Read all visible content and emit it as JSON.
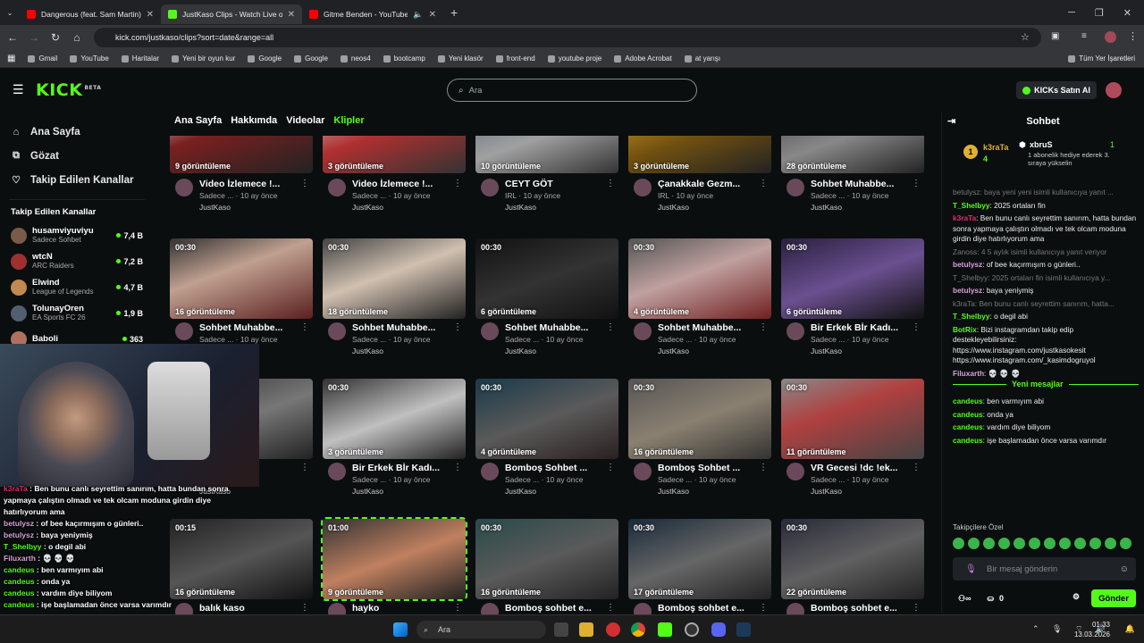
{
  "browser": {
    "tabs": [
      {
        "title": "Dangerous (feat. Sam Martin) -",
        "active": false
      },
      {
        "title": "JustKaso Clips - Watch Live on",
        "active": true
      },
      {
        "title": "Gitme Benden - YouTube",
        "active": false
      }
    ],
    "url": "kick.com/justkaso/clips?sort=date&range=all",
    "bookmarks": [
      "Gmail",
      "YouTube",
      "Haritalar",
      "Yeni bir oyun kur",
      "Google",
      "Google",
      "neos4",
      "bootcamp",
      "Yeni klasör",
      "front-end",
      "youtube proje",
      "Adobe Acrobat",
      "at yarışı"
    ],
    "all_bookmarks": "Tüm Yer İşaretleri"
  },
  "header": {
    "logo": "KICK",
    "search_placeholder": "Ara",
    "buy_label": "KICKs Satın Al"
  },
  "sidebar": {
    "main": [
      {
        "label": "Ana Sayfa",
        "icon": "home-icon"
      },
      {
        "label": "Gözat",
        "icon": "browse-icon"
      },
      {
        "label": "Takip Edilen Kanallar",
        "icon": "heart-icon"
      }
    ],
    "followed_heading": "Takip Edilen Kanallar",
    "channels": [
      {
        "name": "husamviyuviyu",
        "category": "Sadece Sohbet",
        "viewers": "7,4 B",
        "color": "#7a5a48"
      },
      {
        "name": "wtcN",
        "category": "ARC Raiders",
        "viewers": "7,2 B",
        "color": "#a03030"
      },
      {
        "name": "Elwind",
        "category": "League of Legends",
        "viewers": "4,7 B",
        "color": "#c08a50"
      },
      {
        "name": "TolunayOren",
        "category": "EA Sports FC 26",
        "viewers": "1,9 B",
        "color": "#506070"
      },
      {
        "name": "Baboli",
        "category": "",
        "viewers": "363",
        "color": "#b07060"
      }
    ]
  },
  "channel_tabs": [
    "Ana Sayfa",
    "Hakkımda",
    "Videolar",
    "Klipler"
  ],
  "clips": [
    {
      "dur": "",
      "views": "9 görüntüleme",
      "title": "Video İzlemece !...",
      "sub": "Sadece ...  · 10 ay önce",
      "owner": "JustKaso",
      "bg": "linear-gradient(160deg,#ddd 0%,#7a2020 40%,#222 100%)"
    },
    {
      "dur": "",
      "views": "3 görüntüleme",
      "title": "Video İzlemece !...",
      "sub": "Sadece ...  · 10 ay önce",
      "owner": "JustKaso",
      "bg": "linear-gradient(160deg,#ccc 0%,#b03030 45%,#333 100%)"
    },
    {
      "dur": "",
      "views": "10 görüntüleme",
      "title": "CEYT GÖT",
      "sub": "IRL · 10 ay önce",
      "owner": "JustKaso",
      "bg": "linear-gradient(160deg,#5a6a7a 0%,#a0a0a0 50%,#333 100%)"
    },
    {
      "dur": "",
      "views": "3 görüntüleme",
      "title": "Çanakkale Gezm...",
      "sub": "IRL · 10 ay önce",
      "owner": "JustKaso",
      "bg": "linear-gradient(160deg,#d0a020 0%,#705010 50%,#222 100%)"
    },
    {
      "dur": "",
      "views": "28 görüntüleme",
      "title": "Sohbet Muhabbe...",
      "sub": "Sadece ...  · 10 ay önce",
      "owner": "JustKaso",
      "bg": "linear-gradient(160deg,#444 0%,#888 50%,#222 100%)"
    },
    {
      "dur": "00:30",
      "views": "16 görüntüleme",
      "title": "Sohbet Muhabbe...",
      "sub": "Sadece ...  · 10 ay önce",
      "owner": "JustKaso",
      "bg": "linear-gradient(160deg,#333 0%,#c0a090 40%,#5a2020 100%)"
    },
    {
      "dur": "00:30",
      "views": "18 görüntüleme",
      "title": "Sohbet Muhabbe...",
      "sub": "Sadece ...  · 10 ay önce",
      "owner": "JustKaso",
      "bg": "linear-gradient(160deg,#444 0%,#d0c0b0 45%,#222 100%)"
    },
    {
      "dur": "00:30",
      "views": "6 görüntüleme",
      "title": "Sohbet Muhabbe...",
      "sub": "Sadece ...  · 10 ay önce",
      "owner": "JustKaso",
      "bg": "linear-gradient(160deg,#111 0%,#333 50%,#111 100%)"
    },
    {
      "dur": "00:30",
      "views": "4 görüntüleme",
      "title": "Sohbet Muhabbe...",
      "sub": "Sadece ...  · 10 ay önce",
      "owner": "JustKaso",
      "bg": "linear-gradient(160deg,#555 0%,#c0a0a0 45%,#702020 100%)"
    },
    {
      "dur": "00:30",
      "views": "6 görüntüleme",
      "title": "Bir Erkek Bİr Kadı...",
      "sub": "Sadece ...  · 10 ay önce",
      "owner": "JustKaso",
      "bg": "linear-gradient(160deg,#2a2040 0%,#6a5090 50%,#111 100%)"
    },
    {
      "dur": "00:30",
      "views": "",
      "title": "Kadı...",
      "sub": "10 ay önce",
      "owner": "JustKaso",
      "bg": "linear-gradient(160deg,#333 0%,#777 50%,#222 100%)"
    },
    {
      "dur": "00:30",
      "views": "3 görüntüleme",
      "title": "Bir Erkek Bİr Kadı...",
      "sub": "Sadece ...  · 10 ay önce",
      "owner": "JustKaso",
      "bg": "linear-gradient(160deg,#333 0%,#c0c0c0 50%,#222 100%)"
    },
    {
      "dur": "00:30",
      "views": "4 görüntüleme",
      "title": "Bomboş Sohbet ...",
      "sub": "Sadece ...  · 10 ay önce",
      "owner": "JustKaso",
      "bg": "linear-gradient(160deg,#1a3a4a 0%,#5a5a5a 50%,#2a2020 100%)"
    },
    {
      "dur": "00:30",
      "views": "16 görüntüleme",
      "title": "Bomboş Sohbet ...",
      "sub": "Sadece ...  · 10 ay önce",
      "owner": "JustKaso",
      "bg": "linear-gradient(160deg,#555 0%,#8a8070 50%,#333 100%)"
    },
    {
      "dur": "00:30",
      "views": "11 görüntüleme",
      "title": "VR Gecesi !dc !ek...",
      "sub": "Sadece ...  · 10 ay önce",
      "owner": "JustKaso",
      "bg": "linear-gradient(160deg,#888 0%,#b04040 40%,#444 100%)"
    },
    {
      "dur": "00:15",
      "views": "16 görüntüleme",
      "title": "balık kaso",
      "sub": "",
      "owner": "",
      "bg": "linear-gradient(160deg,#222 0%,#555 50%,#111 100%)"
    },
    {
      "dur": "01:00",
      "views": "9 görüntüleme",
      "title": "hayko",
      "sub": "",
      "owner": "",
      "bg": "linear-gradient(160deg,#333 0%,#c08060 50%,#222 100%)"
    },
    {
      "dur": "00:30",
      "views": "16 görüntüleme",
      "title": "Bomboş sohbet e...",
      "sub": "",
      "owner": "",
      "bg": "linear-gradient(160deg,#2a4a4a 0%,#5a5a5a 50%,#222 100%)"
    },
    {
      "dur": "00:30",
      "views": "17 görüntüleme",
      "title": "Bomboş sohbet e...",
      "sub": "",
      "owner": "",
      "bg": "linear-gradient(160deg,#1a2a3a 0%,#666 50%,#222 100%)"
    },
    {
      "dur": "00:30",
      "views": "22 görüntüleme",
      "title": "Bomboş sohbet e...",
      "sub": "",
      "owner": "",
      "bg": "linear-gradient(160deg,#2a2a3a 0%,#606060 50%,#222 100%)"
    }
  ],
  "chat": {
    "title": "Sohbet",
    "pinned": {
      "user1": "k3raTa",
      "user1_count": "4",
      "user2": "xbruS",
      "gift_count": "1",
      "gift_text": "1 abonelik hediye ederek 3. sıraya yükselin"
    },
    "messages": [
      {
        "text": "betulysz: baya yeni yeni isimli kullanıcıya yanıt ...",
        "dim": true
      },
      {
        "user": "T_Shelbyy",
        "color": "#53fc18",
        "text": "2025 ortaları fin"
      },
      {
        "user": "k3raTa",
        "color": "#e0306a",
        "text": "Ben bunu canlı seyrettim sanırım, hatta bundan sonra yapmaya çalıştın olmadı ve tek olcam moduna girdin diye hatırlıyorum ama"
      },
      {
        "text": "Zanoss: 4 5 aylık isimli kullanıcıya yanıt veriyor",
        "dim": true
      },
      {
        "user": "betulysz",
        "color": "#d8a0d8",
        "text": "of bee kaçırmışım o günleri.."
      },
      {
        "text": "T_Shelbyy: 2025 ortaları fin isimli kullanıcıya y...",
        "dim": true
      },
      {
        "user": "betulysz",
        "color": "#d8a0d8",
        "text": "baya yeniymiş"
      },
      {
        "text": "k3raTa: Ben bunu canlı seyrettim sanırım, hatta...",
        "dim": true
      },
      {
        "user": "T_Shelbyy",
        "color": "#53fc18",
        "text": "o degil abi"
      },
      {
        "user": "BotRix",
        "color": "#53fc18",
        "text": "Bizi instagramdan takip edip destekleyebilirsiniz: https://www.instagram.com/justkasokesit https://www.instagram.com/_kasimdogruyol"
      },
      {
        "user": "Filuxarth",
        "color": "#d8a0d8",
        "text": "💀 💀 💀"
      }
    ],
    "new_messages_label": "Yeni mesajlar",
    "new_messages": [
      {
        "user": "candeus",
        "color": "#53fc18",
        "text": "ben varmıyım abi"
      },
      {
        "user": "candeus",
        "color": "#53fc18",
        "text": "onda ya"
      },
      {
        "user": "candeus",
        "color": "#53fc18",
        "text": "vardım diye biliyom"
      },
      {
        "user": "candeus",
        "color": "#53fc18",
        "text": "işe başlamadan önce varsa varımdır"
      }
    ],
    "emote_label": "Takipçilere Özel",
    "input_placeholder": "Bir mesaj gönderin",
    "points": "0",
    "send_label": "Gönder"
  },
  "overlay_chat": [
    {
      "user": "k3raTa",
      "color": "#e0306a",
      "text": "Ben bunu canlı seyrettim sanırım, hatta bundan sonra yapmaya çalıştın olmadı ve tek olcam moduna girdin diye hatırlıyorum ama"
    },
    {
      "user": "betulysz",
      "color": "#d8a0d8",
      "text": "of bee kaçırmışım o günleri.."
    },
    {
      "user": "betulysz",
      "color": "#d8a0d8",
      "text": "baya yeniymiş"
    },
    {
      "user": "T_Shelbyy",
      "color": "#53fc18",
      "text": "o degil abi"
    },
    {
      "user": "Filuxarth",
      "color": "#d8a0d8",
      "text": "💀 💀 💀"
    },
    {
      "user": "candeus",
      "color": "#53fc18",
      "text": "ben varmıyım abi"
    },
    {
      "user": "candeus",
      "color": "#53fc18",
      "text": "onda ya"
    },
    {
      "user": "candeus",
      "color": "#53fc18",
      "text": "vardım diye biliyom"
    },
    {
      "user": "candeus",
      "color": "#53fc18",
      "text": "işe başlamadan önce varsa varımdır"
    }
  ],
  "taskbar": {
    "search": "Ara",
    "time": "01:33",
    "date": "13.03.2026"
  },
  "colors": {
    "accent": "#53fc18",
    "bg": "#0b0e0f"
  }
}
